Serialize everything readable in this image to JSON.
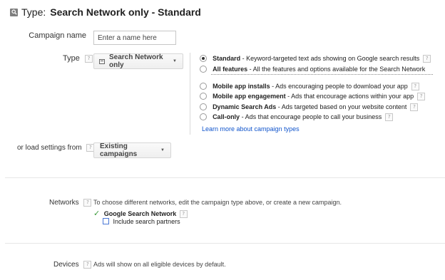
{
  "header": {
    "type_label": "Type:",
    "title": "Search Network only - Standard"
  },
  "campaign_name": {
    "label": "Campaign name",
    "placeholder": "Enter a name here"
  },
  "type_section": {
    "label": "Type",
    "dropdown_label": "Search Network only",
    "options": [
      {
        "title": "Standard",
        "desc": " - Keyword-targeted text ads showing on Google search results",
        "selected": true
      },
      {
        "title": "All features",
        "desc": " - All the features and options available for the Search Network",
        "selected": false
      },
      {
        "title": "Mobile app installs",
        "desc": " - Ads encouraging people to download your app",
        "selected": false
      },
      {
        "title": "Mobile app engagement",
        "desc": " - Ads that encourage actions within your app",
        "selected": false
      },
      {
        "title": "Dynamic Search Ads",
        "desc": " - Ads targeted based on your website content",
        "selected": false
      },
      {
        "title": "Call-only",
        "desc": " - Ads that encourage people to call your business",
        "selected": false
      }
    ],
    "learn_more": "Learn more about campaign types"
  },
  "load_settings": {
    "label": "or load settings from",
    "button_label": "Existing campaigns"
  },
  "networks": {
    "label": "Networks",
    "description": "To choose different networks, edit the campaign type above, or create a new campaign.",
    "google_search": "Google Search Network",
    "include_partners": "Include search partners"
  },
  "devices": {
    "label": "Devices",
    "description": "Ads will show on all eligible devices by default."
  },
  "help_glyph": "?",
  "colors": {
    "link": "#1155cc",
    "check": "#3a9a3a",
    "checkbox": "#4a78d6"
  }
}
